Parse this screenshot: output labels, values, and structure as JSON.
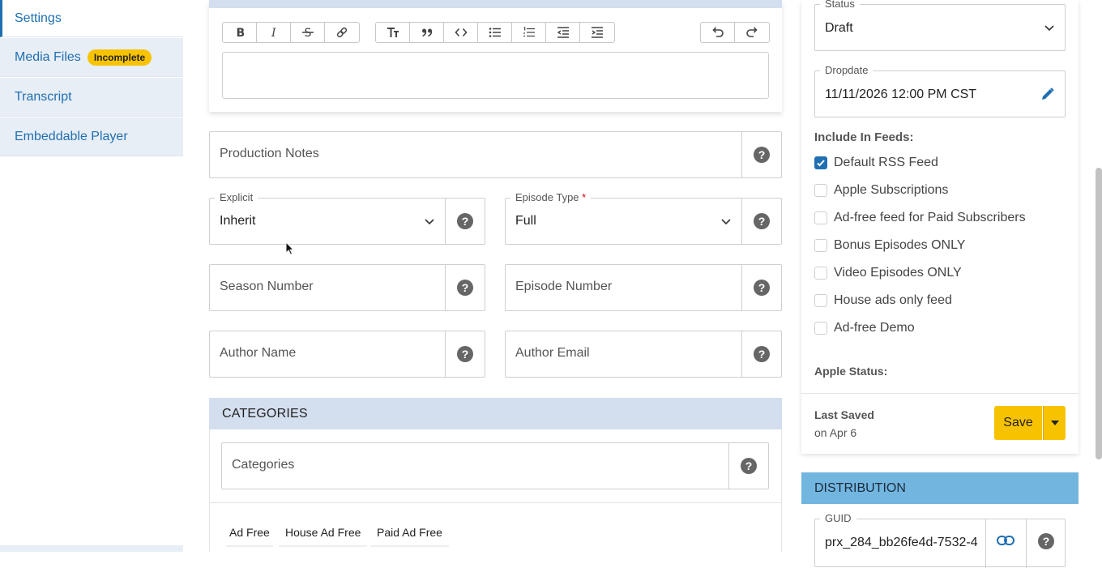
{
  "sidebar": {
    "items": [
      {
        "label": "Settings"
      },
      {
        "label": "Media Files",
        "badge": "Incomplete"
      },
      {
        "label": "Transcript"
      },
      {
        "label": "Embeddable Player"
      }
    ]
  },
  "editor": {
    "toolbar": [
      "bold-icon",
      "italic-icon",
      "strikethrough-icon",
      "link-icon",
      "heading-icon",
      "quote-icon",
      "code-icon",
      "bullet-list-icon",
      "numbered-list-icon",
      "outdent-icon",
      "indent-icon",
      "undo-icon",
      "redo-icon"
    ]
  },
  "form": {
    "production_notes": {
      "placeholder": "Production Notes"
    },
    "explicit": {
      "label": "Explicit",
      "value": "Inherit"
    },
    "episode_type": {
      "label": "Episode Type",
      "required_mark": "*",
      "value": "Full"
    },
    "season_number": {
      "placeholder": "Season Number"
    },
    "episode_number": {
      "placeholder": "Episode Number"
    },
    "author_name": {
      "placeholder": "Author Name"
    },
    "author_email": {
      "placeholder": "Author Email"
    },
    "help": "?"
  },
  "categories": {
    "header": "CATEGORIES",
    "input_placeholder": "Categories",
    "tags": [
      "Ad Free",
      "House Ad Free",
      "Paid Ad Free"
    ]
  },
  "publish": {
    "status_label": "Status",
    "status_value": "Draft",
    "dropdate_label": "Dropdate",
    "dropdate_value": "11/11/2026 12:00 PM CST",
    "feeds_title": "Include In Feeds:",
    "feeds": [
      {
        "label": "Default RSS Feed",
        "checked": true
      },
      {
        "label": "Apple Subscriptions",
        "checked": false
      },
      {
        "label": "Ad-free feed for Paid Subscribers",
        "checked": false
      },
      {
        "label": "Bonus Episodes ONLY",
        "checked": false
      },
      {
        "label": "Video Episodes ONLY",
        "checked": false
      },
      {
        "label": "House ads only feed",
        "checked": false
      },
      {
        "label": "Ad-free Demo",
        "checked": false
      }
    ],
    "apple_status_label": "Apple Status:",
    "last_saved_label": "Last Saved",
    "last_saved_date": "on Apr 6",
    "save_label": "Save"
  },
  "distribution": {
    "header": "DISTRIBUTION",
    "guid_label": "GUID",
    "guid_value": "prx_284_bb26fe4d-7532-4"
  },
  "colors": {
    "accent_blue": "#1f6fb2",
    "save_yellow": "#f7c300",
    "section_header": "#d3deef",
    "distribution_header": "#72b6e0"
  }
}
